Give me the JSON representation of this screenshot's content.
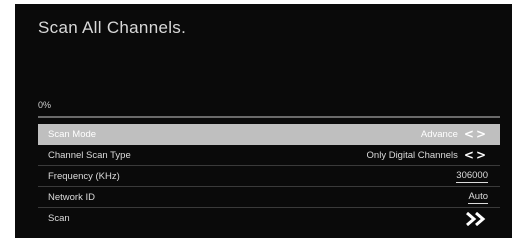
{
  "title": "Scan All Channels.",
  "progress": {
    "label": "0%",
    "value": 0
  },
  "menu": {
    "items": [
      {
        "label": "Scan Mode",
        "value": "Advance",
        "icon": "left-right-arrows-icon",
        "selected": true
      },
      {
        "label": "Channel Scan Type",
        "value": "Only Digital Channels",
        "icon": "left-right-arrows-icon",
        "selected": false
      },
      {
        "label": "Frequency (KHz)",
        "value": "306000",
        "selected": false
      },
      {
        "label": "Network ID",
        "value": "Auto",
        "selected": false
      },
      {
        "label": "Scan",
        "icon": "double-chevron-right-icon",
        "selected": false
      }
    ]
  },
  "colors": {
    "background": "#0a0a0a",
    "selected_row": "#bfbfbf",
    "text": "#dcdcdc",
    "divider": "#3a3a3a"
  }
}
